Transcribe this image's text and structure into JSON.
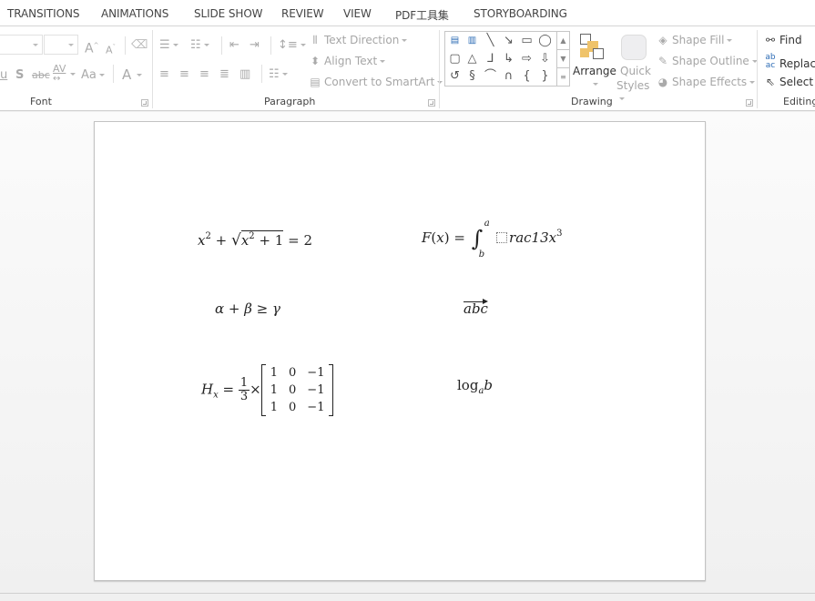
{
  "tabs": [
    "TRANSITIONS",
    "ANIMATIONS",
    "SLIDE SHOW",
    "REVIEW",
    "VIEW",
    "PDF工具集",
    "STORYBOARDING"
  ],
  "ribbon": {
    "font": {
      "label": "Font",
      "font_name_value": "",
      "font_size_value": "",
      "grow_font": "A",
      "shrink_font": "A",
      "shadow": "S",
      "strikethrough": "abc",
      "spacing": "AV",
      "change_case": "Aa",
      "font_color": "A"
    },
    "paragraph": {
      "label": "Paragraph",
      "text_direction": "Text Direction",
      "align_text": "Align Text",
      "convert_smartart": "Convert to SmartArt"
    },
    "drawing": {
      "label": "Drawing",
      "arrange": "Arrange",
      "quick_styles_1": "Quick",
      "quick_styles_2": "Styles",
      "shape_fill": "Shape Fill",
      "shape_outline": "Shape Outline",
      "shape_effects": "Shape Effects",
      "shapes": [
        "text-box",
        "vertical-text-box",
        "line",
        "arrow",
        "rectangle",
        "oval",
        "rounded-rectangle",
        "triangle",
        "elbow-connector",
        "elbow-arrow-connector",
        "right-arrow",
        "down-arrow",
        "freeform",
        "scribble",
        "arc",
        "curve",
        "left-brace",
        "right-brace"
      ]
    },
    "editing": {
      "label": "Editing",
      "find": "Find",
      "replace": "Replace",
      "select": "Select"
    }
  },
  "slide": {
    "equations": {
      "eq1": {
        "x": "x",
        "two": "2",
        "plus": "+",
        "x2": "x",
        "two2": "2",
        "plus1": "+ 1",
        "eq": "= 2"
      },
      "eq2": {
        "F": "F",
        "open": "(",
        "x": "x",
        "close": ")",
        "eq": "=",
        "upper": "a",
        "lower": "b",
        "body": "rac13x",
        "exp": "3"
      },
      "eq3": {
        "text": "α + β ≥ γ"
      },
      "eq4": {
        "text": "abc"
      },
      "eq5": {
        "H": "H",
        "sub": "x",
        "eq": "=",
        "num": "1",
        "den": "3",
        "times": "×",
        "matrix": [
          [
            "1",
            "0",
            "−1"
          ],
          [
            "1",
            "0",
            "−1"
          ],
          [
            "1",
            "0",
            "−1"
          ]
        ]
      },
      "eq6": {
        "log": "log",
        "base": "a",
        "arg": "b"
      }
    }
  }
}
